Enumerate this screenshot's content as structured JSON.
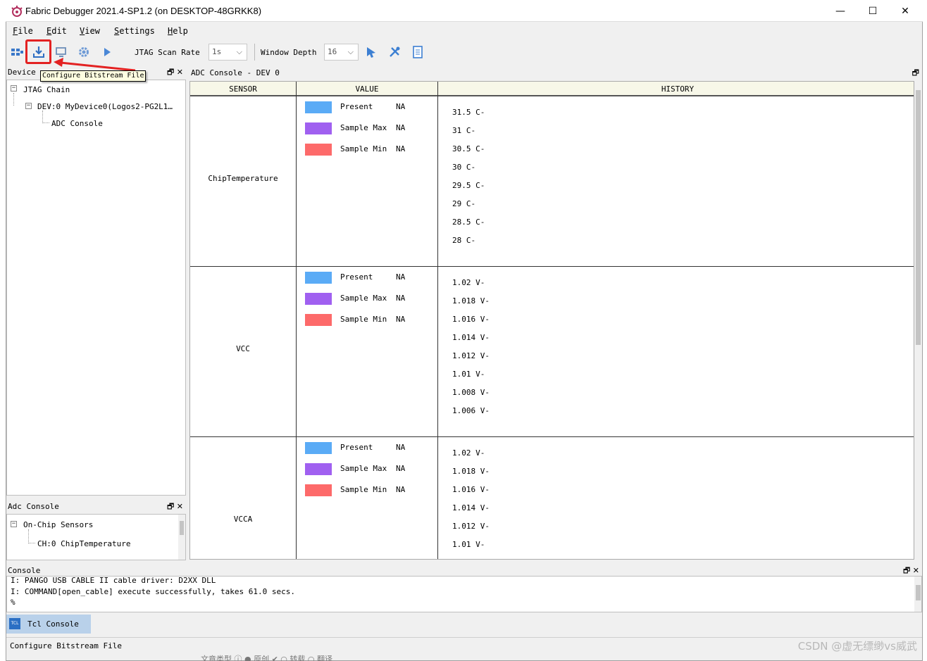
{
  "window": {
    "title": "Fabric Debugger 2021.4-SP1.2 (on DESKTOP-48GRKK8)",
    "minimize": "—",
    "maximize": "☐",
    "close": "✕"
  },
  "menu": [
    {
      "key": "F",
      "rest": "ile"
    },
    {
      "key": "E",
      "rest": "dit"
    },
    {
      "key": "V",
      "rest": "iew"
    },
    {
      "key": "S",
      "rest": "ettings"
    },
    {
      "key": "H",
      "rest": "elp"
    }
  ],
  "toolbar": {
    "scan_rate_label": "JTAG Scan Rate",
    "scan_rate_value": "1s",
    "window_depth_label": "Window Depth",
    "window_depth_value": "16",
    "tooltip": "Configure Bitstream File"
  },
  "device_panel": {
    "title": "Device",
    "tree": {
      "root": "JTAG Chain",
      "device": "DEV:0 MyDevice0(Logos2-PG2L1…",
      "leaf": "ADC Console"
    }
  },
  "adc_panel": {
    "title": "Adc Console",
    "tree": {
      "root": "On-Chip Sensors",
      "leaf": "CH:0 ChipTemperature"
    }
  },
  "adc_console": {
    "title": "ADC Console - DEV 0",
    "columns": {
      "sensor": "SENSOR",
      "value": "VALUE",
      "history": "HISTORY"
    },
    "legend_colors": {
      "present": "#5aabf6",
      "max": "#a060f0",
      "min": "#fd6a6a"
    },
    "sensors": [
      {
        "name": "ChipTemperature",
        "values": [
          {
            "label": "Present",
            "value": "NA"
          },
          {
            "label": "Sample Max",
            "value": "NA"
          },
          {
            "label": "Sample Min",
            "value": "NA"
          }
        ],
        "history": [
          "31.5 C-",
          "31 C-",
          "30.5 C-",
          "30 C-",
          "29.5 C-",
          "29 C-",
          "28.5 C-",
          "28 C-"
        ]
      },
      {
        "name": "VCC",
        "values": [
          {
            "label": "Present",
            "value": "NA"
          },
          {
            "label": "Sample Max",
            "value": "NA"
          },
          {
            "label": "Sample Min",
            "value": "NA"
          }
        ],
        "history": [
          "1.02 V-",
          "1.018 V-",
          "1.016 V-",
          "1.014 V-",
          "1.012 V-",
          "1.01 V-",
          "1.008 V-",
          "1.006 V-"
        ]
      },
      {
        "name": "VCCA",
        "values": [
          {
            "label": "Present",
            "value": "NA"
          },
          {
            "label": "Sample Max",
            "value": "NA"
          },
          {
            "label": "Sample Min",
            "value": "NA"
          }
        ],
        "history": [
          "1.02 V-",
          "1.018 V-",
          "1.016 V-",
          "1.014 V-",
          "1.012 V-",
          "1.01 V-"
        ]
      }
    ]
  },
  "console": {
    "title": "Console",
    "lines": [
      "I: PANGO USB CABLE II cable driver: D2XX DLL",
      "I: COMMAND[open_cable] execute successfully, takes 61.0 secs.",
      "%"
    ],
    "tab_label": "Tcl Console",
    "tab_icon_text": "TCL"
  },
  "status_bar": "Configure Bitstream File",
  "watermark": "CSDN @虚无缥缈vs威武",
  "underlay_text": "文章类型 ⓘ   ● 原创 ✔    ○ 转载    ○ 翻译"
}
